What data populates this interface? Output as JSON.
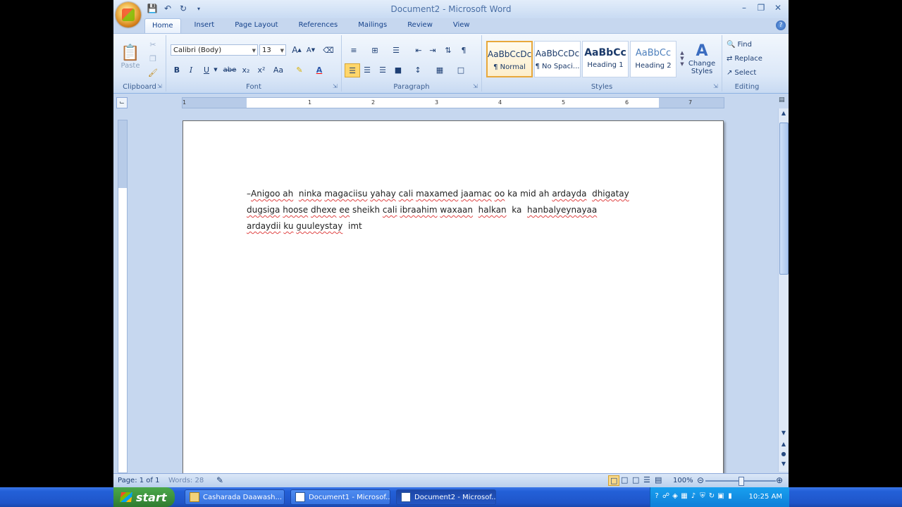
{
  "app": {
    "title": "Document2 - Microsoft Word",
    "quick_access": [
      "save-icon",
      "undo-icon",
      "redo-icon",
      "customize-icon"
    ]
  },
  "tabs": [
    "Home",
    "Insert",
    "Page Layout",
    "References",
    "Mailings",
    "Review",
    "View"
  ],
  "ribbon": {
    "clipboard": {
      "label": "Clipboard",
      "paste": "Paste"
    },
    "font": {
      "label": "Font",
      "name": "Calibri (Body)",
      "size": "13",
      "bold": "B",
      "italic": "I",
      "underline": "U",
      "strike": "abe",
      "subscript": "x₂",
      "superscript": "x²",
      "case": "Aa",
      "grow": "A",
      "shrink": "A"
    },
    "paragraph": {
      "label": "Paragraph",
      "show_marks": "¶"
    },
    "styles": {
      "label": "Styles",
      "items": [
        {
          "sample": "AaBbCcDc",
          "name": "¶ Normal",
          "selected": true
        },
        {
          "sample": "AaBbCcDc",
          "name": "¶ No Spaci...",
          "selected": false
        },
        {
          "sample": "AaBbCc",
          "name": "Heading 1",
          "selected": false
        },
        {
          "sample": "AaBbCc",
          "name": "Heading 2",
          "selected": false
        }
      ],
      "change_styles_1": "Change",
      "change_styles_2": "Styles"
    },
    "editing": {
      "label": "Editing",
      "find": "Find",
      "replace": "Replace",
      "select": "Select"
    }
  },
  "ruler": {
    "ticks": [
      "1",
      "1",
      "2",
      "3",
      "4",
      "5",
      "6",
      "7"
    ]
  },
  "document": {
    "line1": [
      "Anigoo ah",
      "ninka",
      "magaciisu",
      "yahay",
      "cali",
      "maxamed",
      "jaamac",
      "oo",
      "ka mid ah",
      "ardayda",
      "dhigatay"
    ],
    "line2": [
      "dugsiga",
      "hoose",
      "dhexe",
      "ee",
      "sheikh",
      "cali",
      "ibraahim",
      "waxaan",
      "halkan",
      "ka",
      "hanbalyeynayaa"
    ],
    "line3": [
      "ardaydii",
      "ku",
      "guuleystay",
      "imt"
    ]
  },
  "status": {
    "page": "Page: 1 of 1",
    "words": "Words: 28",
    "zoom": "100%"
  },
  "taskbar": {
    "start": "start",
    "tasks": [
      {
        "label": "Casharada Daawash...",
        "icon": "folder-icon"
      },
      {
        "label": "Document1 - Microsof...",
        "icon": "word-doc-icon"
      },
      {
        "label": "Document2 - Microsof...",
        "icon": "word-doc-icon"
      }
    ],
    "clock": "10:25 AM"
  }
}
